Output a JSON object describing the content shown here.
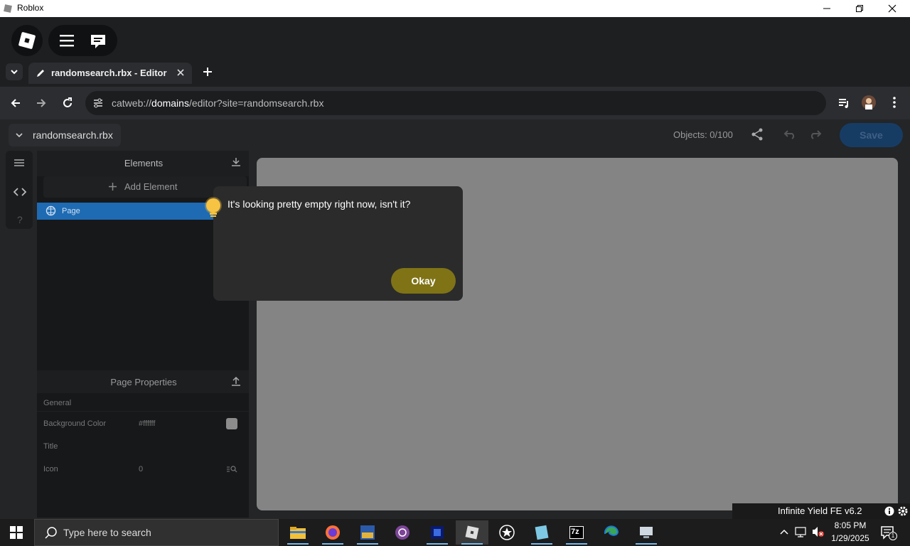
{
  "window": {
    "title": "Roblox"
  },
  "browser": {
    "tab_title": "randomsearch.rbx - Editor",
    "url_prefix": "catweb://",
    "url_host": "domains",
    "url_rest": "/editor?site=randomsearch.rbx"
  },
  "editor": {
    "site_name": "randomsearch.rbx",
    "objects_count": "Objects: 0/100",
    "save_label": "Save",
    "elements_header": "Elements",
    "add_element_label": "Add Element",
    "tree": [
      {
        "label": "Page"
      }
    ],
    "left_nav_help": "?",
    "properties_header": "Page Properties",
    "general_label": "General",
    "props": {
      "bg_label": "Background Color",
      "bg_value": "#ffffff",
      "title_label": "Title",
      "icon_label": "Icon",
      "icon_value": "0"
    }
  },
  "dialog": {
    "message": "It's looking pretty empty right now, isn't it?",
    "ok_label": "Okay"
  },
  "overlay": {
    "infinite_yield": "Infinite Yield FE v6.2"
  },
  "taskbar": {
    "search_placeholder": "Type here to search",
    "time": "8:05 PM",
    "date": "1/29/2025",
    "notification_count": "1",
    "zip_label": "7z"
  },
  "colors": {
    "accent_yellow": "#7f7316",
    "selection_blue": "#1e6bb3",
    "save_blue": "#173c64"
  }
}
